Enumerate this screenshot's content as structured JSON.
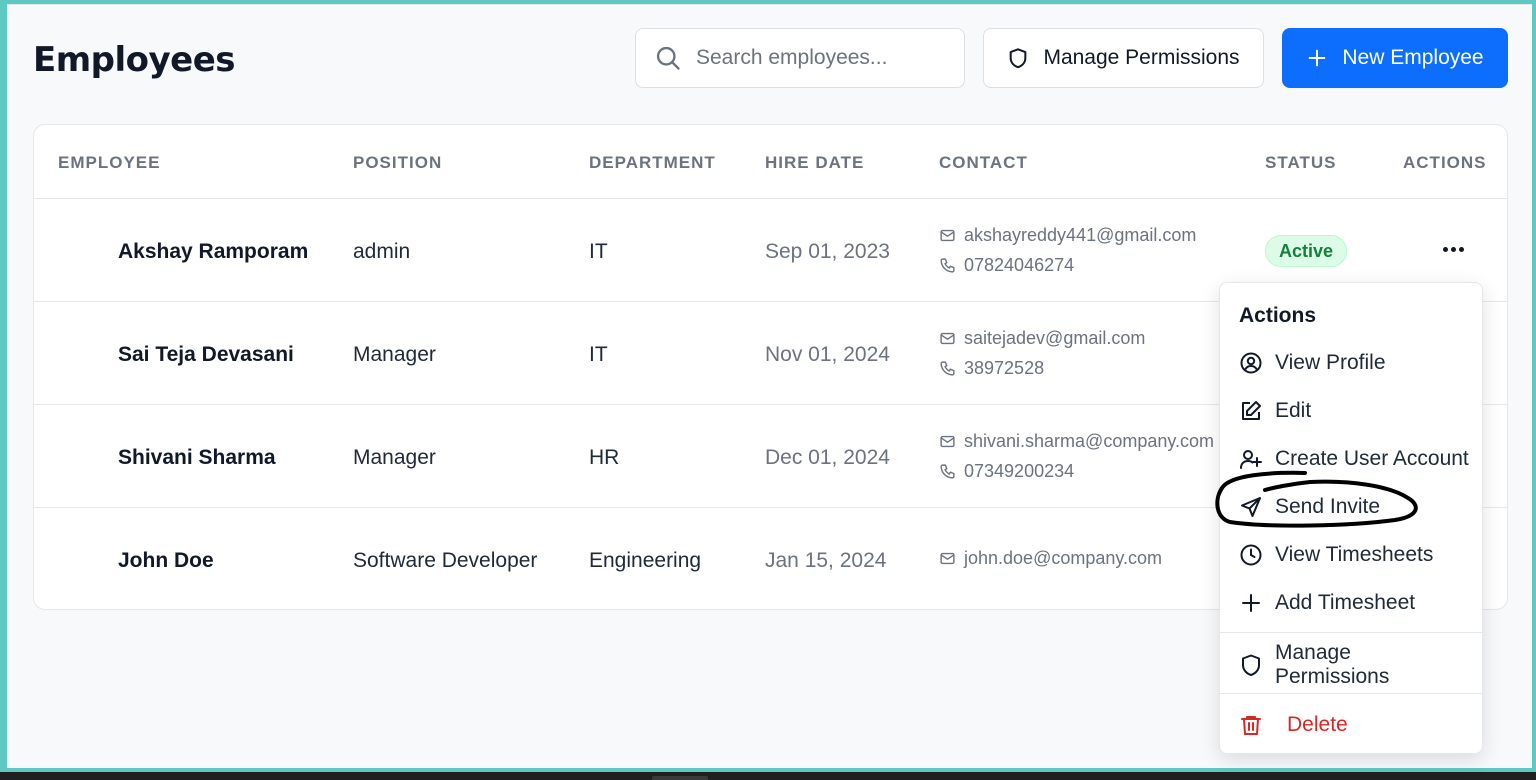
{
  "page": {
    "title": "Employees"
  },
  "search": {
    "placeholder": "Search employees..."
  },
  "toolbar": {
    "manage_permissions_label": "Manage Permissions",
    "new_employee_label": "New Employee",
    "accent_color": "#0d6efd"
  },
  "table": {
    "headers": [
      "EMPLOYEE",
      "POSITION",
      "DEPARTMENT",
      "HIRE DATE",
      "CONTACT",
      "STATUS",
      "ACTIONS"
    ],
    "rows": [
      {
        "name": "Akshay Ramporam",
        "position": "admin",
        "department": "IT",
        "hire_date": "Sep 01, 2023",
        "email": "akshayreddy441@gmail.com",
        "phone": "07824046274",
        "status": "Active"
      },
      {
        "name": "Sai Teja Devasani",
        "position": "Manager",
        "department": "IT",
        "hire_date": "Nov 01, 2024",
        "email": "saitejadev@gmail.com",
        "phone": "38972528"
      },
      {
        "name": "Shivani Sharma",
        "position": "Manager",
        "department": "HR",
        "hire_date": "Dec 01, 2024",
        "email": "shivani.sharma@company.com",
        "phone": "07349200234"
      },
      {
        "name": "John Doe",
        "position": "Software Developer",
        "department": "Engineering",
        "hire_date": "Jan 15, 2024",
        "email": "john.doe@company.com"
      }
    ]
  },
  "actions_menu": {
    "title": "Actions",
    "items": [
      {
        "label": "View Profile",
        "icon": "user-circle-icon"
      },
      {
        "label": "Edit",
        "icon": "edit-icon"
      },
      {
        "label": "Create User Account",
        "icon": "user-plus-icon"
      },
      {
        "label": "Send Invite",
        "icon": "send-icon"
      },
      {
        "label": "View Timesheets",
        "icon": "clock-icon"
      },
      {
        "label": "Add Timesheet",
        "icon": "plus-icon"
      },
      {
        "label": "Manage Permissions",
        "icon": "shield-icon"
      },
      {
        "label": "Delete",
        "icon": "trash-icon",
        "color": "#dc2626"
      }
    ]
  },
  "status_colors": {
    "active_bg": "#dcfce7",
    "active_text": "#15803d"
  }
}
